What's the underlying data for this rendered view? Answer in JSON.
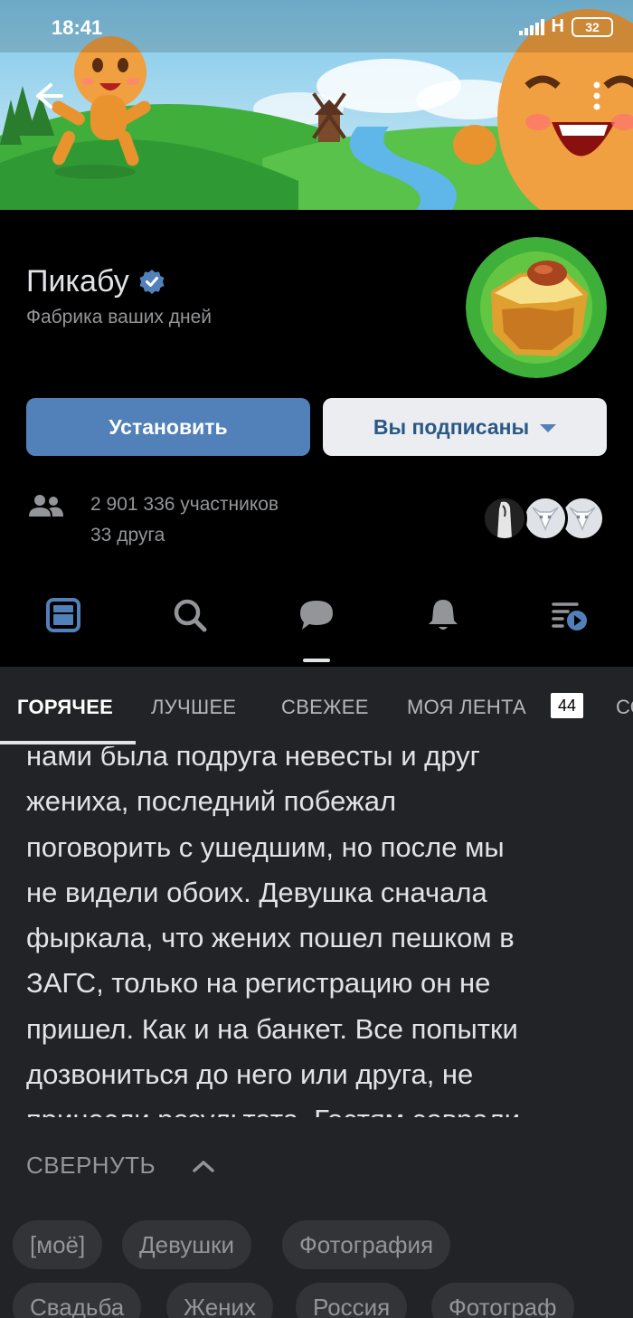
{
  "status_bar": {
    "time": "18:41",
    "network": "H",
    "battery": "32"
  },
  "group": {
    "name": "Пикабу",
    "subtitle": "Фабрика ваших дней",
    "verified": true
  },
  "buttons": {
    "install": "Установить",
    "subscribed": "Вы подписаны"
  },
  "stats": {
    "members": "2 901 336 участников",
    "friends": "33 друга"
  },
  "nav_icons": [
    "feed-icon",
    "search-icon",
    "comments-icon",
    "notifications-icon",
    "playlist-icon"
  ],
  "tabs": [
    {
      "label": "ГОРЯЧЕЕ",
      "active": true
    },
    {
      "label": "ЛУЧШЕЕ",
      "active": false
    },
    {
      "label": "СВЕЖЕЕ",
      "active": false
    },
    {
      "label": "МОЯ ЛЕНТА",
      "active": false
    },
    {
      "label": "СО",
      "active": false
    }
  ],
  "tab_badge": "44",
  "post": {
    "lines": [
      "нами была подруга невесты и друг",
      "жениха, последний побежал",
      "поговорить с ушедшим, но после мы",
      "не видели обоих. Девушка сначала",
      "фыркала, что жених пошел пешком в",
      "ЗАГС, только на регистрацию он не",
      "пришел. Как и на банкет. Все попытки",
      "дозвониться до него или друга, не",
      "принесли результата. Гостям соврали"
    ],
    "collapse_label": "СВЕРНУТЬ"
  },
  "tags": [
    "[моё]",
    "Девушки",
    "Фотография",
    "Свадьба",
    "Жених",
    "Россия",
    "Фотограф"
  ],
  "colors": {
    "accent": "#5181b8",
    "background": "#000000",
    "feed_background": "#222326",
    "tag_background": "#323438"
  }
}
